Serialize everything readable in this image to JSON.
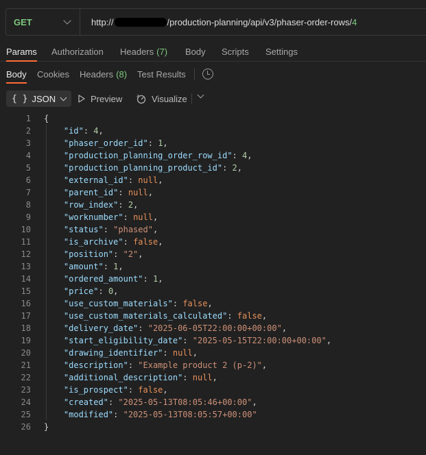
{
  "request": {
    "method": "GET",
    "url_prefix": "http://",
    "url_path": "/production-planning/api/v3/phaser-order-rows/",
    "url_id": "4"
  },
  "request_tabs": [
    {
      "label": "Params",
      "badge": ""
    },
    {
      "label": "Authorization",
      "badge": ""
    },
    {
      "label": "Headers",
      "badge": "(7)"
    },
    {
      "label": "Body",
      "badge": ""
    },
    {
      "label": "Scripts",
      "badge": ""
    },
    {
      "label": "Settings",
      "badge": ""
    }
  ],
  "response_tabs": [
    {
      "label": "Body",
      "badge": ""
    },
    {
      "label": "Cookies",
      "badge": ""
    },
    {
      "label": "Headers",
      "badge": "(8)"
    },
    {
      "label": "Test Results",
      "badge": ""
    }
  ],
  "toolbar": {
    "format_icon": "{ }",
    "format_label": "JSON",
    "preview_label": "Preview",
    "visualize_label": "Visualize"
  },
  "colors": {
    "accent": "#ff6c37",
    "method": "#7ec97e"
  },
  "response_body": [
    {
      "n": "1",
      "t": "open"
    },
    {
      "n": "2",
      "k": "id",
      "v": "4",
      "type": "num"
    },
    {
      "n": "3",
      "k": "phaser_order_id",
      "v": "1",
      "type": "num"
    },
    {
      "n": "4",
      "k": "production_planning_order_row_id",
      "v": "4",
      "type": "num"
    },
    {
      "n": "5",
      "k": "production_planning_product_id",
      "v": "2",
      "type": "num"
    },
    {
      "n": "6",
      "k": "external_id",
      "v": "null",
      "type": "lit"
    },
    {
      "n": "7",
      "k": "parent_id",
      "v": "null",
      "type": "lit"
    },
    {
      "n": "8",
      "k": "row_index",
      "v": "2",
      "type": "num"
    },
    {
      "n": "9",
      "k": "worknumber",
      "v": "null",
      "type": "lit"
    },
    {
      "n": "10",
      "k": "status",
      "v": "\"phased\"",
      "type": "str"
    },
    {
      "n": "11",
      "k": "is_archive",
      "v": "false",
      "type": "lit"
    },
    {
      "n": "12",
      "k": "position",
      "v": "\"2\"",
      "type": "str"
    },
    {
      "n": "13",
      "k": "amount",
      "v": "1",
      "type": "num"
    },
    {
      "n": "14",
      "k": "ordered_amount",
      "v": "1",
      "type": "num"
    },
    {
      "n": "15",
      "k": "price",
      "v": "0",
      "type": "num"
    },
    {
      "n": "16",
      "k": "use_custom_materials",
      "v": "false",
      "type": "lit"
    },
    {
      "n": "17",
      "k": "use_custom_materials_calculated",
      "v": "false",
      "type": "lit"
    },
    {
      "n": "18",
      "k": "delivery_date",
      "v": "\"2025-06-05T22:00:00+00:00\"",
      "type": "str"
    },
    {
      "n": "19",
      "k": "start_eligibility_date",
      "v": "\"2025-05-15T22:00:00+00:00\"",
      "type": "str"
    },
    {
      "n": "20",
      "k": "drawing_identifier",
      "v": "null",
      "type": "lit"
    },
    {
      "n": "21",
      "k": "description",
      "v": "\"Example product 2 (p-2)\"",
      "type": "str"
    },
    {
      "n": "22",
      "k": "additional_description",
      "v": "null",
      "type": "lit"
    },
    {
      "n": "23",
      "k": "is_prospect",
      "v": "false",
      "type": "lit"
    },
    {
      "n": "24",
      "k": "created",
      "v": "\"2025-05-13T08:05:46+00:00\"",
      "type": "str"
    },
    {
      "n": "25",
      "k": "modified",
      "v": "\"2025-05-13T08:05:57+00:00\"",
      "type": "str",
      "last": true
    },
    {
      "n": "26",
      "t": "close"
    }
  ]
}
